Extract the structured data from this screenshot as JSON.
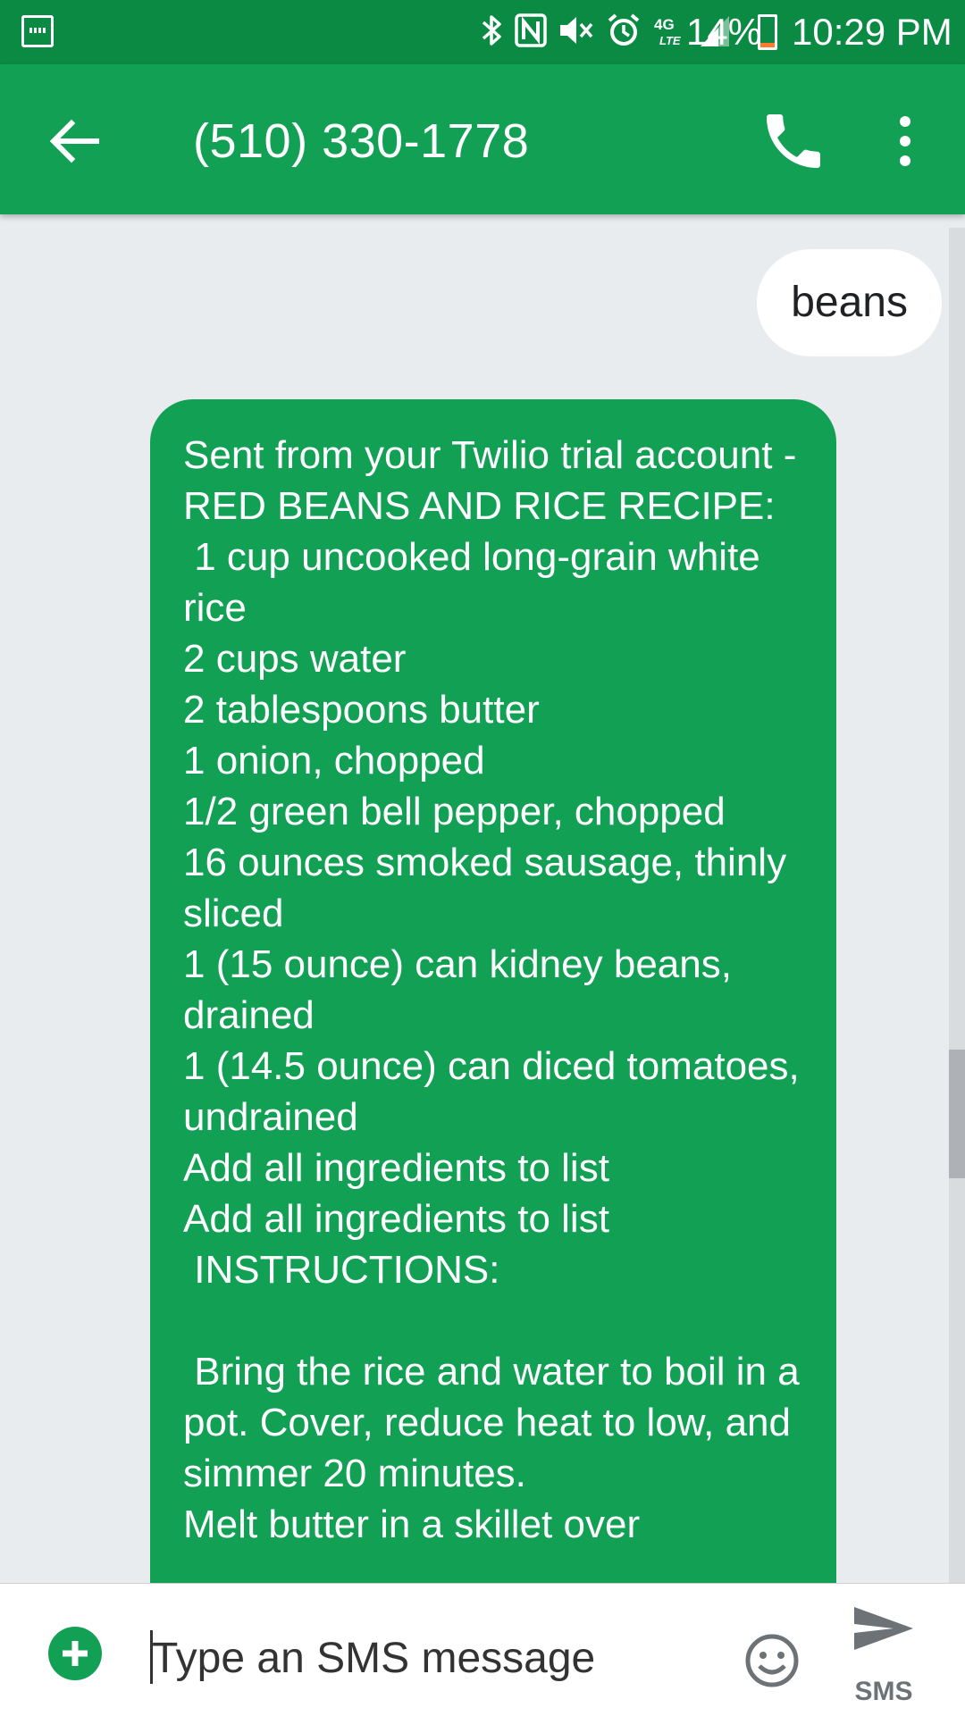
{
  "status_bar": {
    "network": "4G LTE",
    "battery": "14%",
    "battery_level": 0.14,
    "time": "10:29 PM",
    "icons": [
      "screenshot-icon",
      "bluetooth-icon",
      "nfc-icon",
      "mute-icon",
      "alarm-icon",
      "lte-icon",
      "signal-icon",
      "battery-icon"
    ]
  },
  "app_bar": {
    "title": "(510) 330-1778",
    "back_icon": "arrow-left-icon",
    "call_icon": "phone-icon",
    "menu_icon": "more-vert-icon"
  },
  "messages": [
    {
      "direction": "outgoing",
      "text": "beans"
    },
    {
      "direction": "incoming",
      "text": "Sent from your Twilio trial account - RED BEANS AND RICE RECIPE:\n 1 cup uncooked long-grain white rice\n2 cups water\n2 tablespoons butter\n1 onion, chopped\n1/2 green bell pepper, chopped\n16 ounces smoked sausage, thinly sliced\n1 (15 ounce) can kidney beans, drained\n1 (14.5 ounce) can diced tomatoes, undrained\nAdd all ingredients to list\nAdd all ingredients to list\n INSTRUCTIONS:\n\n Bring the rice and water to boil in a pot. Cover, reduce heat to low, and simmer 20 minutes.\nMelt butter in a skillet over"
    }
  ],
  "compose": {
    "placeholder": "Type an SMS message",
    "send_label": "SMS",
    "add_icon": "plus-circle-icon",
    "emoji_icon": "emoji-icon",
    "send_icon": "send-icon"
  },
  "colors": {
    "status_bar": "#0b8a44",
    "accent": "#12a055",
    "background": "#e9ecef"
  }
}
